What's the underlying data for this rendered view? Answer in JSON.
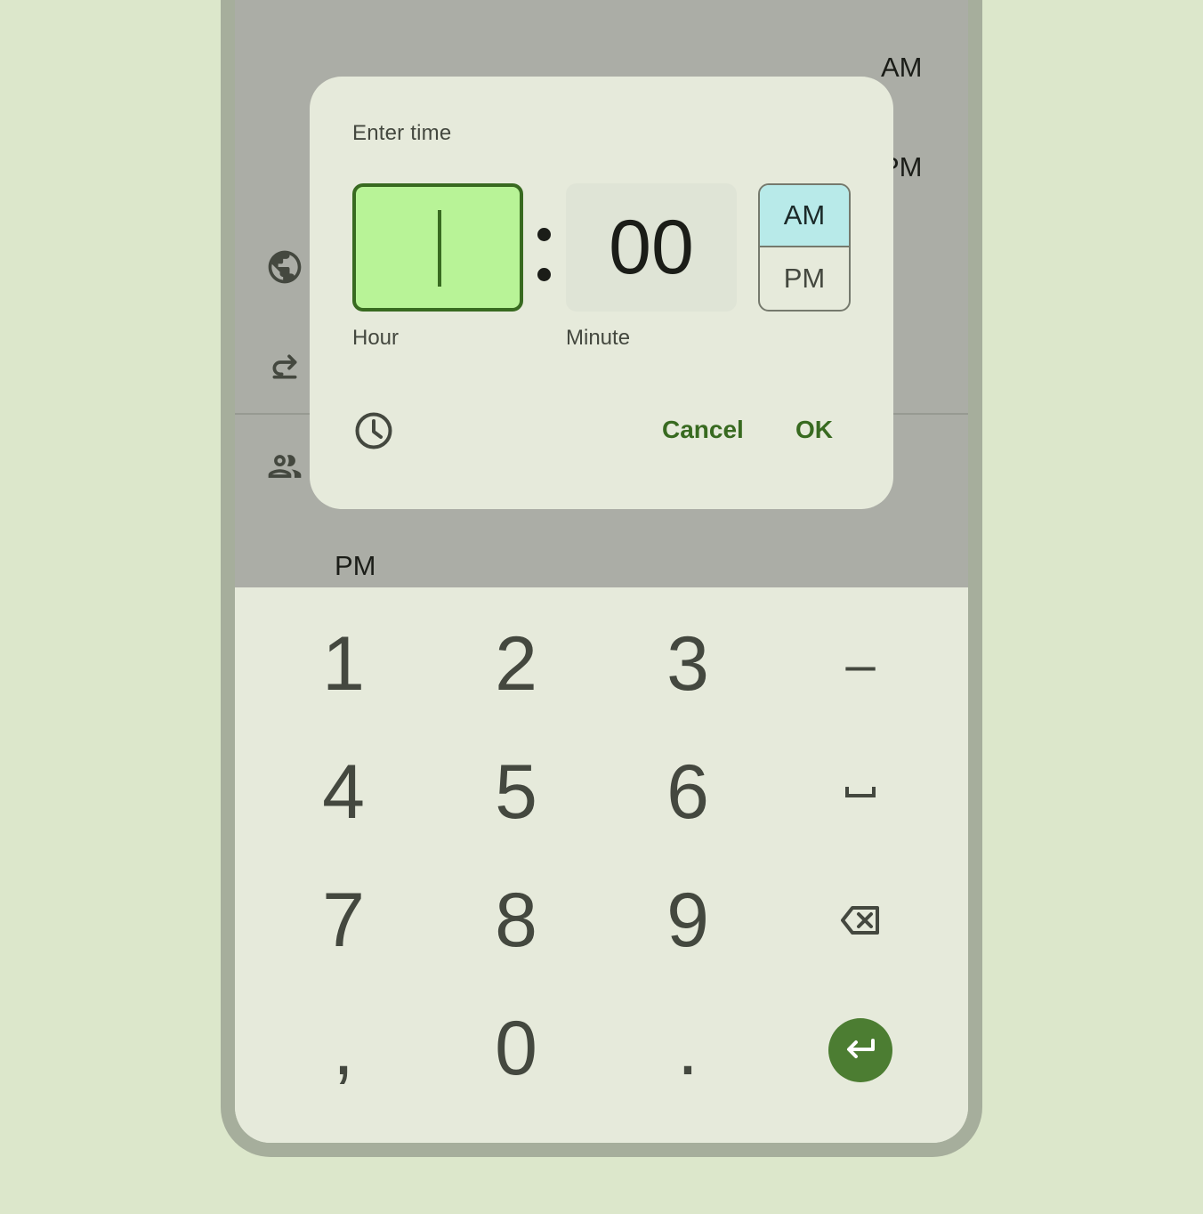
{
  "background": {
    "am_label": "AM",
    "pm_label": "PM",
    "pm_label_lower": "PM"
  },
  "dialog": {
    "title": "Enter time",
    "hour_value": "",
    "minute_value": "00",
    "hour_label": "Hour",
    "minute_label": "Minute",
    "am": "AM",
    "pm": "PM",
    "selected_period": "AM",
    "cancel": "Cancel",
    "ok": "OK"
  },
  "keyboard": {
    "k1": "1",
    "k2": "2",
    "k3": "3",
    "dash": "–",
    "k4": "4",
    "k5": "5",
    "k6": "6",
    "k7": "7",
    "k8": "8",
    "k9": "9",
    "comma": ",",
    "k0": "0",
    "period": "."
  },
  "colors": {
    "accent": "#386a20",
    "hour_field": "#b8f397",
    "am_selected": "#b8eae9",
    "enter_key": "#4c7d32",
    "scrim": "#abada6",
    "page_bg": "#dce7cb"
  },
  "icons": [
    "globe-icon",
    "redo-icon",
    "people-icon",
    "clock-icon",
    "space-icon",
    "backspace-icon",
    "enter-icon"
  ]
}
